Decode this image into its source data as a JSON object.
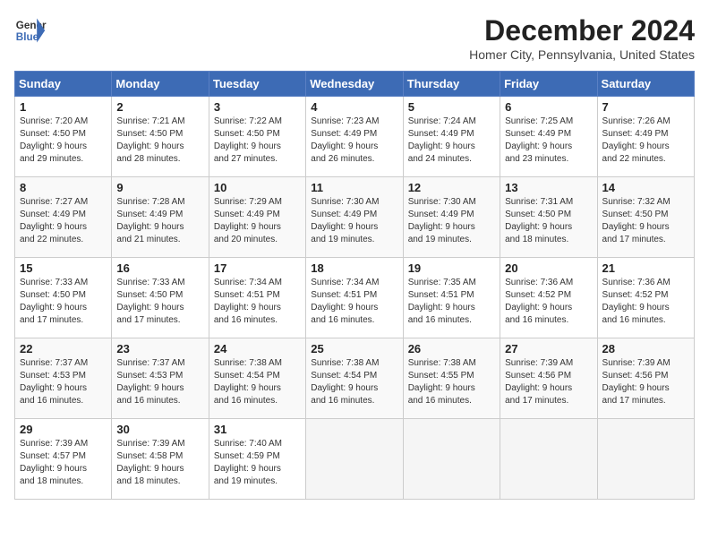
{
  "header": {
    "logo_line1": "General",
    "logo_line2": "Blue",
    "month": "December 2024",
    "location": "Homer City, Pennsylvania, United States"
  },
  "days_of_week": [
    "Sunday",
    "Monday",
    "Tuesday",
    "Wednesday",
    "Thursday",
    "Friday",
    "Saturday"
  ],
  "weeks": [
    [
      {
        "day": "1",
        "info": "Sunrise: 7:20 AM\nSunset: 4:50 PM\nDaylight: 9 hours\nand 29 minutes."
      },
      {
        "day": "2",
        "info": "Sunrise: 7:21 AM\nSunset: 4:50 PM\nDaylight: 9 hours\nand 28 minutes."
      },
      {
        "day": "3",
        "info": "Sunrise: 7:22 AM\nSunset: 4:50 PM\nDaylight: 9 hours\nand 27 minutes."
      },
      {
        "day": "4",
        "info": "Sunrise: 7:23 AM\nSunset: 4:49 PM\nDaylight: 9 hours\nand 26 minutes."
      },
      {
        "day": "5",
        "info": "Sunrise: 7:24 AM\nSunset: 4:49 PM\nDaylight: 9 hours\nand 24 minutes."
      },
      {
        "day": "6",
        "info": "Sunrise: 7:25 AM\nSunset: 4:49 PM\nDaylight: 9 hours\nand 23 minutes."
      },
      {
        "day": "7",
        "info": "Sunrise: 7:26 AM\nSunset: 4:49 PM\nDaylight: 9 hours\nand 22 minutes."
      }
    ],
    [
      {
        "day": "8",
        "info": "Sunrise: 7:27 AM\nSunset: 4:49 PM\nDaylight: 9 hours\nand 22 minutes."
      },
      {
        "day": "9",
        "info": "Sunrise: 7:28 AM\nSunset: 4:49 PM\nDaylight: 9 hours\nand 21 minutes."
      },
      {
        "day": "10",
        "info": "Sunrise: 7:29 AM\nSunset: 4:49 PM\nDaylight: 9 hours\nand 20 minutes."
      },
      {
        "day": "11",
        "info": "Sunrise: 7:30 AM\nSunset: 4:49 PM\nDaylight: 9 hours\nand 19 minutes."
      },
      {
        "day": "12",
        "info": "Sunrise: 7:30 AM\nSunset: 4:49 PM\nDaylight: 9 hours\nand 19 minutes."
      },
      {
        "day": "13",
        "info": "Sunrise: 7:31 AM\nSunset: 4:50 PM\nDaylight: 9 hours\nand 18 minutes."
      },
      {
        "day": "14",
        "info": "Sunrise: 7:32 AM\nSunset: 4:50 PM\nDaylight: 9 hours\nand 17 minutes."
      }
    ],
    [
      {
        "day": "15",
        "info": "Sunrise: 7:33 AM\nSunset: 4:50 PM\nDaylight: 9 hours\nand 17 minutes."
      },
      {
        "day": "16",
        "info": "Sunrise: 7:33 AM\nSunset: 4:50 PM\nDaylight: 9 hours\nand 17 minutes."
      },
      {
        "day": "17",
        "info": "Sunrise: 7:34 AM\nSunset: 4:51 PM\nDaylight: 9 hours\nand 16 minutes."
      },
      {
        "day": "18",
        "info": "Sunrise: 7:34 AM\nSunset: 4:51 PM\nDaylight: 9 hours\nand 16 minutes."
      },
      {
        "day": "19",
        "info": "Sunrise: 7:35 AM\nSunset: 4:51 PM\nDaylight: 9 hours\nand 16 minutes."
      },
      {
        "day": "20",
        "info": "Sunrise: 7:36 AM\nSunset: 4:52 PM\nDaylight: 9 hours\nand 16 minutes."
      },
      {
        "day": "21",
        "info": "Sunrise: 7:36 AM\nSunset: 4:52 PM\nDaylight: 9 hours\nand 16 minutes."
      }
    ],
    [
      {
        "day": "22",
        "info": "Sunrise: 7:37 AM\nSunset: 4:53 PM\nDaylight: 9 hours\nand 16 minutes."
      },
      {
        "day": "23",
        "info": "Sunrise: 7:37 AM\nSunset: 4:53 PM\nDaylight: 9 hours\nand 16 minutes."
      },
      {
        "day": "24",
        "info": "Sunrise: 7:38 AM\nSunset: 4:54 PM\nDaylight: 9 hours\nand 16 minutes."
      },
      {
        "day": "25",
        "info": "Sunrise: 7:38 AM\nSunset: 4:54 PM\nDaylight: 9 hours\nand 16 minutes."
      },
      {
        "day": "26",
        "info": "Sunrise: 7:38 AM\nSunset: 4:55 PM\nDaylight: 9 hours\nand 16 minutes."
      },
      {
        "day": "27",
        "info": "Sunrise: 7:39 AM\nSunset: 4:56 PM\nDaylight: 9 hours\nand 17 minutes."
      },
      {
        "day": "28",
        "info": "Sunrise: 7:39 AM\nSunset: 4:56 PM\nDaylight: 9 hours\nand 17 minutes."
      }
    ],
    [
      {
        "day": "29",
        "info": "Sunrise: 7:39 AM\nSunset: 4:57 PM\nDaylight: 9 hours\nand 18 minutes."
      },
      {
        "day": "30",
        "info": "Sunrise: 7:39 AM\nSunset: 4:58 PM\nDaylight: 9 hours\nand 18 minutes."
      },
      {
        "day": "31",
        "info": "Sunrise: 7:40 AM\nSunset: 4:59 PM\nDaylight: 9 hours\nand 19 minutes."
      },
      null,
      null,
      null,
      null
    ]
  ]
}
